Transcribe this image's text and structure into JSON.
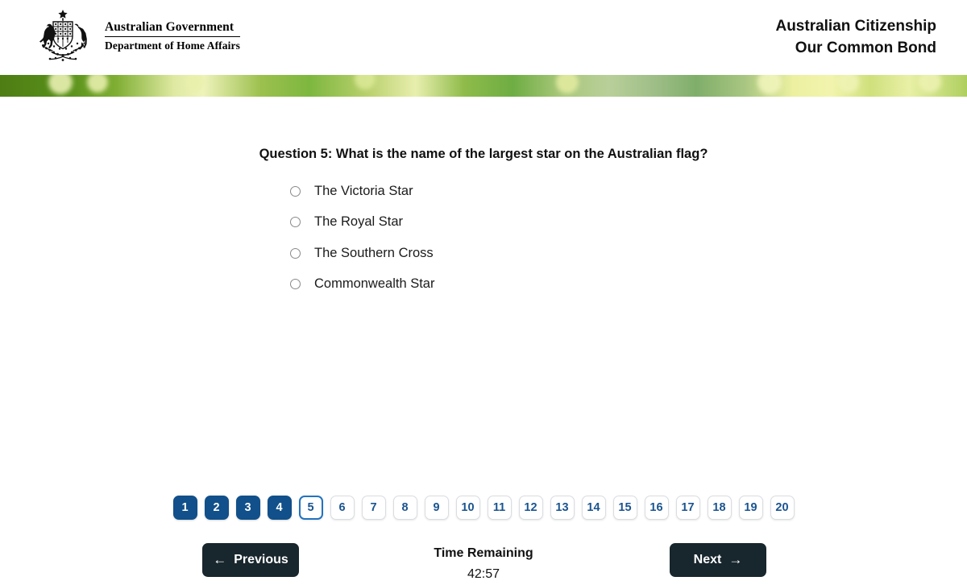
{
  "header": {
    "crest_icon": "australian-coat-of-arms",
    "government_line1": "Australian Government",
    "government_line2": "Department of Home Affairs",
    "title_line1": "Australian Citizenship",
    "title_line2": "Our Common Bond"
  },
  "banner": {
    "image_name": "golden-wattle-banner"
  },
  "quiz": {
    "question": "Question 5: What is the name of the largest star on the Australian flag?",
    "question_number": 5,
    "options": [
      {
        "label": "The Victoria Star",
        "selected": false
      },
      {
        "label": "The Royal Star",
        "selected": false
      },
      {
        "label": "The Southern Cross",
        "selected": false
      },
      {
        "label": "Commonwealth Star",
        "selected": false
      }
    ]
  },
  "pagination": {
    "pages": [
      {
        "number": "1",
        "state": "answered"
      },
      {
        "number": "2",
        "state": "answered"
      },
      {
        "number": "3",
        "state": "answered"
      },
      {
        "number": "4",
        "state": "answered"
      },
      {
        "number": "5",
        "state": "current"
      },
      {
        "number": "6",
        "state": "unanswered"
      },
      {
        "number": "7",
        "state": "unanswered"
      },
      {
        "number": "8",
        "state": "unanswered"
      },
      {
        "number": "9",
        "state": "unanswered"
      },
      {
        "number": "10",
        "state": "unanswered"
      },
      {
        "number": "11",
        "state": "unanswered"
      },
      {
        "number": "12",
        "state": "unanswered"
      },
      {
        "number": "13",
        "state": "unanswered"
      },
      {
        "number": "14",
        "state": "unanswered"
      },
      {
        "number": "15",
        "state": "unanswered"
      },
      {
        "number": "16",
        "state": "unanswered"
      },
      {
        "number": "17",
        "state": "unanswered"
      },
      {
        "number": "18",
        "state": "unanswered"
      },
      {
        "number": "19",
        "state": "unanswered"
      },
      {
        "number": "20",
        "state": "unanswered"
      }
    ]
  },
  "controls": {
    "previous_label": "Previous",
    "previous_arrow": "←",
    "next_label": "Next",
    "next_arrow": "→",
    "timer_title": "Time Remaining",
    "timer_value": "42:57"
  },
  "colors": {
    "answered_page": "#11508a",
    "current_page_border": "#2173c0",
    "nav_button": "#18262d",
    "page_text": "#1a5490"
  }
}
